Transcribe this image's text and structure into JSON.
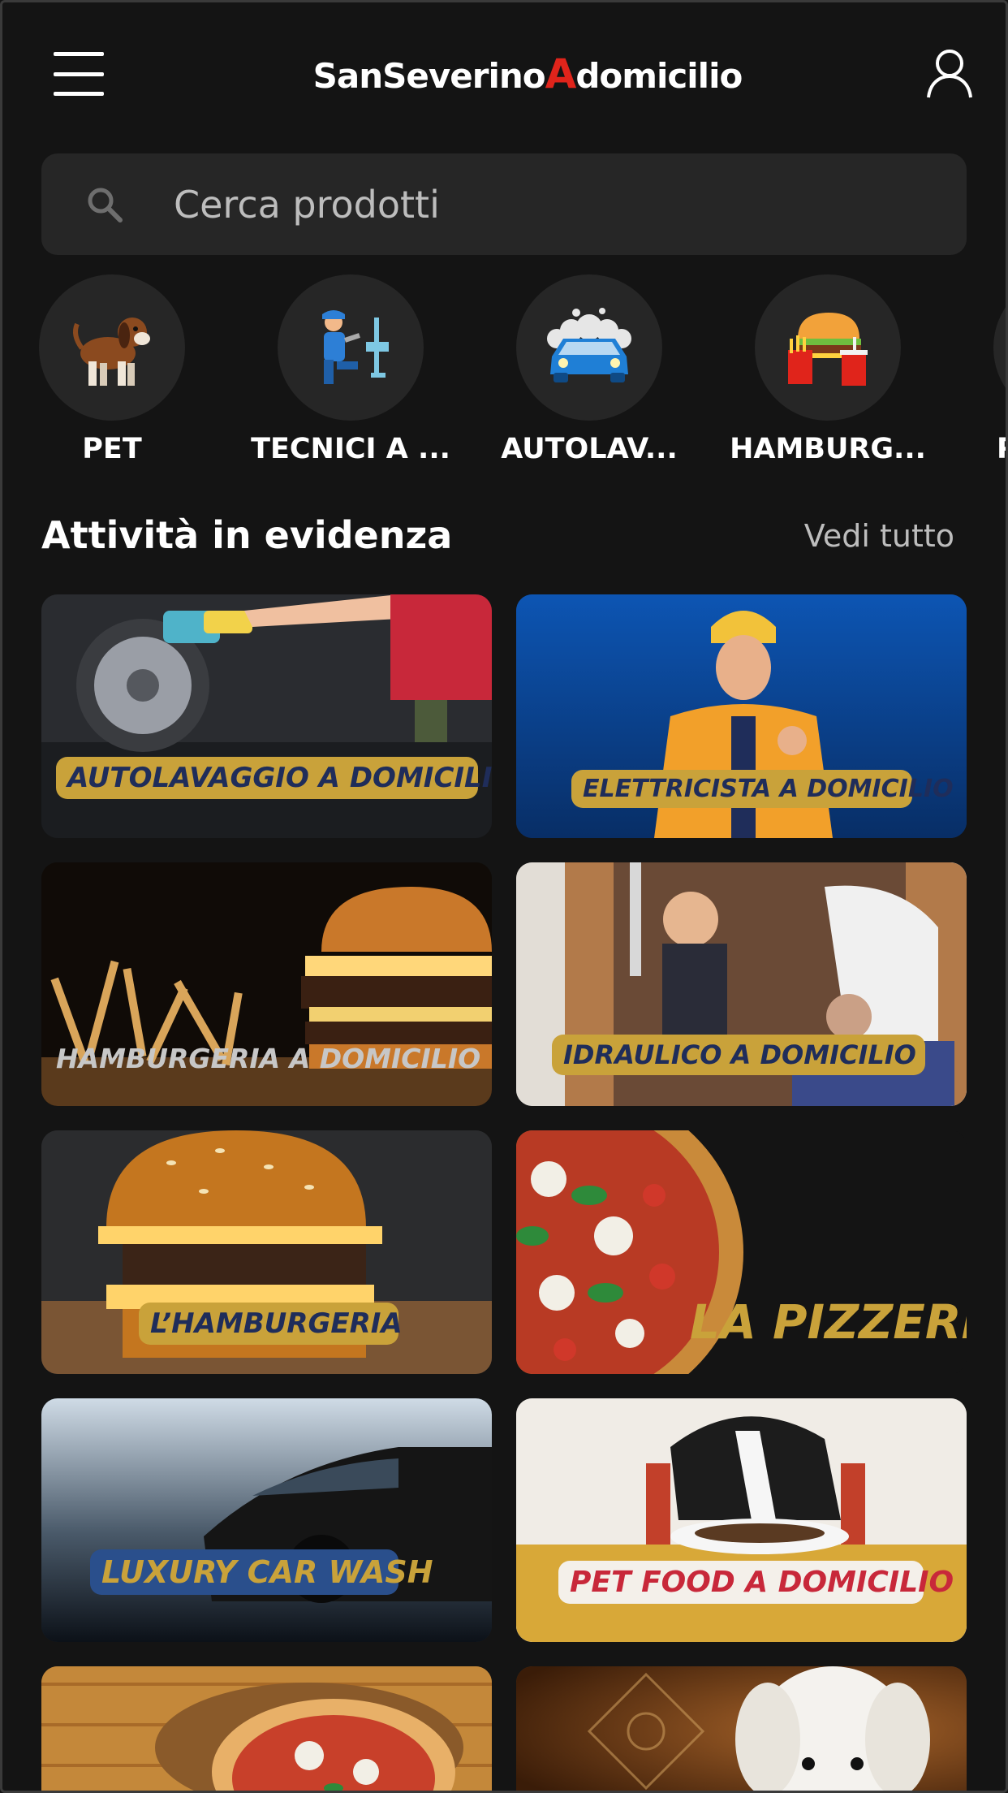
{
  "header": {
    "logo_part1": "SanSeverino",
    "logo_part2": "A",
    "logo_part3": "domicilio"
  },
  "search": {
    "placeholder": "Cerca prodotti"
  },
  "categories": [
    {
      "label": "PET",
      "icon": "dog-icon"
    },
    {
      "label": "TECNICI A ...",
      "icon": "technician-icon"
    },
    {
      "label": "AUTOLAV...",
      "icon": "car-wash-icon"
    },
    {
      "label": "HAMBURG...",
      "icon": "burger-icon"
    },
    {
      "label": "P",
      "icon": "category-icon"
    }
  ],
  "featured": {
    "title": "Attività in evidenza",
    "see_all": "Vedi tutto",
    "cards": [
      {
        "banner": "AUTOLAVAGGIO A DOMICILIO"
      },
      {
        "banner": "ELETTRICISTA A DOMICILIO"
      },
      {
        "banner": "HAMBURGERIA A DOMICILIO"
      },
      {
        "banner": "IDRAULICO A DOMICILIO"
      },
      {
        "banner": "L’HAMBURGERIA"
      },
      {
        "banner": "LA PIZZERIA"
      },
      {
        "banner": "LUXURY CAR WASH"
      },
      {
        "banner": "PET FOOD A DOMICILIO"
      },
      {
        "banner": ""
      },
      {
        "banner": ""
      }
    ]
  },
  "colors": {
    "background": "#141414",
    "surface": "#262626",
    "logo_accent": "#e0241b",
    "banner_gold": "#c9a23a",
    "banner_navy": "#1f2d5a"
  }
}
